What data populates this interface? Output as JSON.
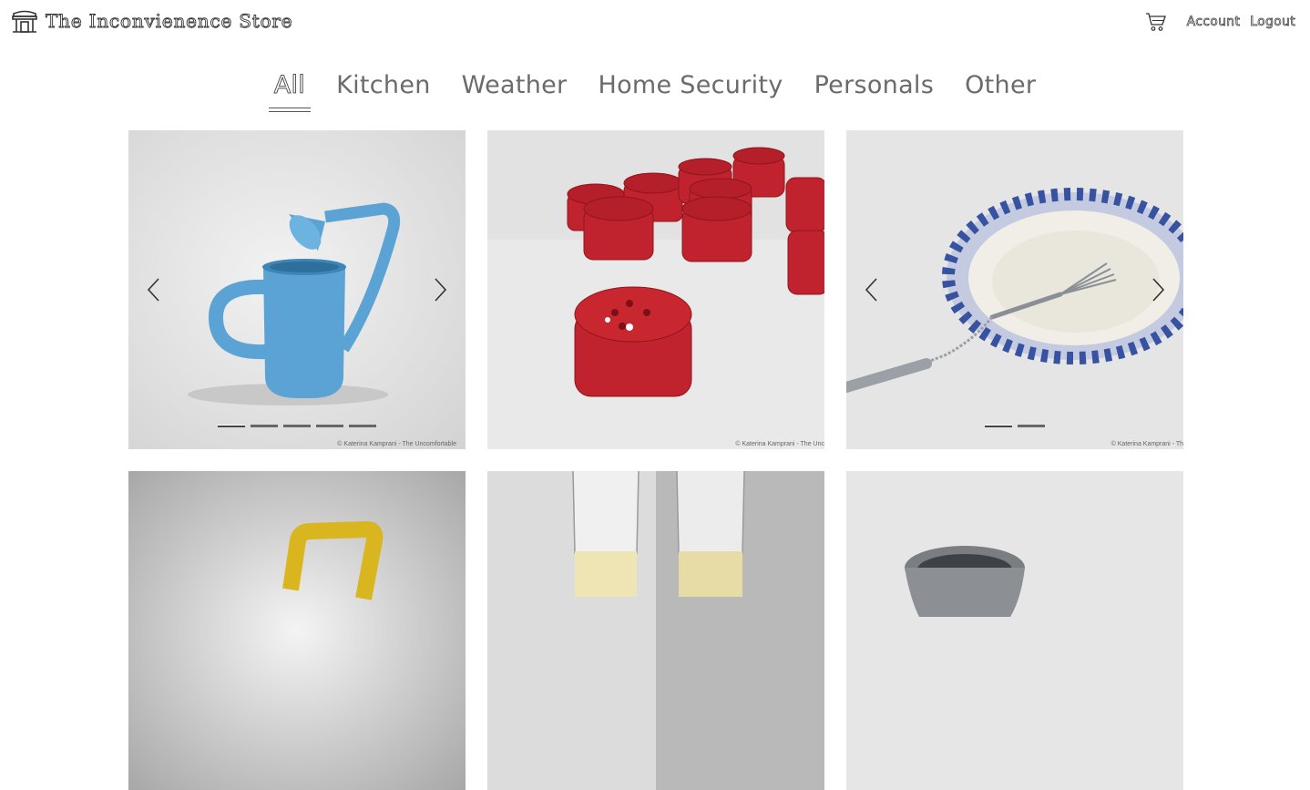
{
  "header": {
    "brand_name": "The Inconvienence Store",
    "account_label": "Account",
    "logout_label": "Logout",
    "icons": {
      "logo": "storefront-icon",
      "cart": "cart-icon"
    }
  },
  "tabs": [
    {
      "label": "All",
      "active": true
    },
    {
      "label": "Kitchen",
      "active": false
    },
    {
      "label": "Weather",
      "active": false
    },
    {
      "label": "Home Security",
      "active": false
    },
    {
      "label": "Personals",
      "active": false
    },
    {
      "label": "Other",
      "active": false
    }
  ],
  "products": [
    {
      "image": "blue watering can",
      "dots": 5,
      "active_dot": 1,
      "has_arrows": true,
      "credit": "© Katerina Kamprani - The Uncomfortable"
    },
    {
      "image": "red salt shakers",
      "dots": 0,
      "has_arrows": false,
      "credit": "© Katerina Kamprani - The Unc"
    },
    {
      "image": "plate with chained fork",
      "dots": 2,
      "active_dot": 1,
      "has_arrows": true,
      "credit": "© Katerina Kamprani - Th"
    },
    {
      "image": "yellow handle",
      "dots": 0,
      "has_arrows": false
    },
    {
      "image": "champagne glasses",
      "dots": 0,
      "has_arrows": false
    },
    {
      "image": "steel pitcher",
      "dots": 0,
      "has_arrows": false
    }
  ]
}
